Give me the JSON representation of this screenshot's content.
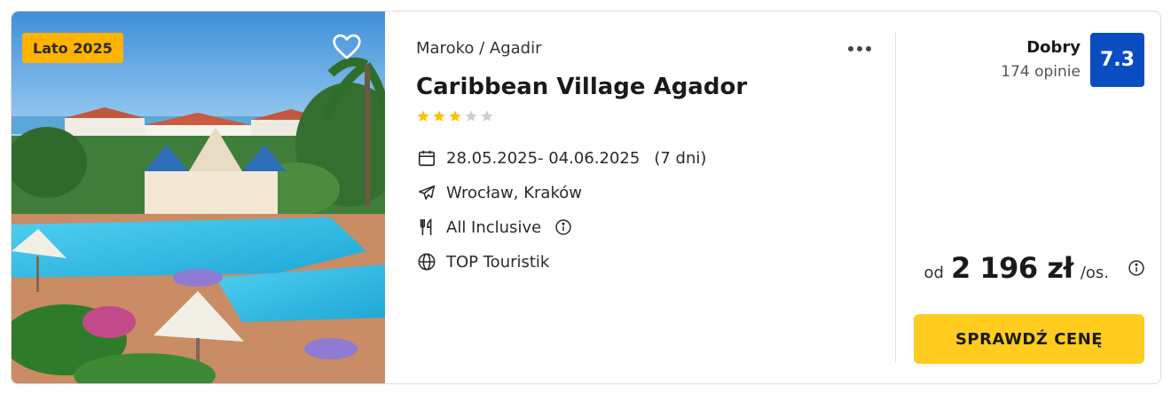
{
  "offer": {
    "season_badge": "Lato 2025",
    "location": "Maroko / Agadir",
    "hotel_name": "Caribbean Village Agador",
    "stars": {
      "value": 3,
      "max": 5
    },
    "dates": "28.05.2025- 04.06.2025",
    "duration": "(7 dni)",
    "airports": "Wrocław, Kraków",
    "board": "All Inclusive",
    "operator": "TOP Touristik",
    "rating": {
      "label": "Dobry",
      "reviews": "174 opinie",
      "score": "7.3"
    },
    "price": {
      "from": "od",
      "value": "2 196 zł",
      "unit": "/os."
    },
    "cta_label": "SPRAWDŹ CENĘ"
  },
  "colors": {
    "badge": "#ffb300",
    "score_bg": "#0a4dc2",
    "cta_bg": "#ffcc1f",
    "star_on": "#ffc107",
    "star_off": "#d0d0d0"
  },
  "icons": {
    "favorite": "heart-icon",
    "more": "more-dots-icon",
    "dates": "calendar-icon",
    "airports": "plane-icon",
    "board": "cutlery-icon",
    "operator": "globe-icon",
    "info": "info-icon"
  }
}
